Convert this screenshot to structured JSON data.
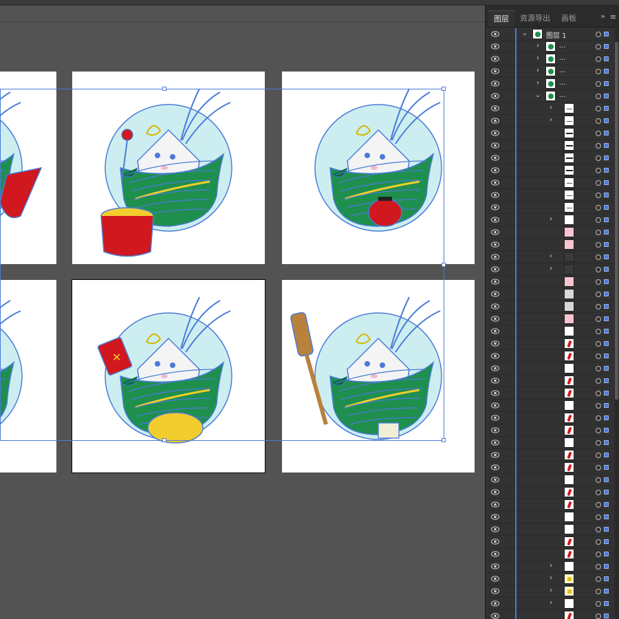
{
  "panel": {
    "tabs": [
      "图层",
      "资源导出",
      "画板"
    ],
    "active_tab": 0,
    "collapse_glyph": "»",
    "menu_glyph": "≡"
  },
  "layers": [
    {
      "name": "图层 1",
      "depth": 0,
      "expander": "open",
      "thumb": "artwork"
    },
    {
      "name": "...",
      "depth": 1,
      "expander": "closed",
      "thumb": "artwork"
    },
    {
      "name": "...",
      "depth": 1,
      "expander": "closed",
      "thumb": "artwork"
    },
    {
      "name": "...",
      "depth": 1,
      "expander": "closed",
      "thumb": "artwork"
    },
    {
      "name": "...",
      "depth": 1,
      "expander": "closed",
      "thumb": "artwork"
    },
    {
      "name": "...",
      "depth": 1,
      "expander": "open",
      "thumb": "artwork"
    },
    {
      "name": "",
      "depth": 2,
      "expander": "closed",
      "thumb": "line"
    },
    {
      "name": "",
      "depth": 2,
      "expander": "closed",
      "thumb": "line"
    },
    {
      "name": "",
      "depth": 2,
      "expander": "none",
      "thumb": "black"
    },
    {
      "name": "",
      "depth": 2,
      "expander": "none",
      "thumb": "black"
    },
    {
      "name": "",
      "depth": 2,
      "expander": "none",
      "thumb": "black"
    },
    {
      "name": "",
      "depth": 2,
      "expander": "none",
      "thumb": "black"
    },
    {
      "name": "",
      "depth": 2,
      "expander": "none",
      "thumb": "line"
    },
    {
      "name": "",
      "depth": 2,
      "expander": "none",
      "thumb": "line"
    },
    {
      "name": "",
      "depth": 2,
      "expander": "none",
      "thumb": "line"
    },
    {
      "name": "",
      "depth": 2,
      "expander": "closed",
      "thumb": "blank"
    },
    {
      "name": "",
      "depth": 2,
      "expander": "none",
      "thumb": "pink"
    },
    {
      "name": "",
      "depth": 2,
      "expander": "none",
      "thumb": "pink"
    },
    {
      "name": "",
      "depth": 2,
      "expander": "closed",
      "thumb": "dark"
    },
    {
      "name": "",
      "depth": 2,
      "expander": "closed",
      "thumb": "dark"
    },
    {
      "name": "",
      "depth": 2,
      "expander": "none",
      "thumb": "pink"
    },
    {
      "name": "",
      "depth": 2,
      "expander": "none",
      "thumb": "grey"
    },
    {
      "name": "",
      "depth": 2,
      "expander": "none",
      "thumb": "grey"
    },
    {
      "name": "",
      "depth": 2,
      "expander": "none",
      "thumb": "pink"
    },
    {
      "name": "",
      "depth": 2,
      "expander": "none",
      "thumb": "blank"
    },
    {
      "name": "",
      "depth": 2,
      "expander": "none",
      "thumb": "red"
    },
    {
      "name": "",
      "depth": 2,
      "expander": "none",
      "thumb": "red"
    },
    {
      "name": "",
      "depth": 2,
      "expander": "none",
      "thumb": "blank"
    },
    {
      "name": "",
      "depth": 2,
      "expander": "none",
      "thumb": "red"
    },
    {
      "name": "",
      "depth": 2,
      "expander": "none",
      "thumb": "red"
    },
    {
      "name": "",
      "depth": 2,
      "expander": "none",
      "thumb": "blank"
    },
    {
      "name": "",
      "depth": 2,
      "expander": "none",
      "thumb": "red"
    },
    {
      "name": "",
      "depth": 2,
      "expander": "none",
      "thumb": "red"
    },
    {
      "name": "",
      "depth": 2,
      "expander": "none",
      "thumb": "blank"
    },
    {
      "name": "",
      "depth": 2,
      "expander": "none",
      "thumb": "red"
    },
    {
      "name": "",
      "depth": 2,
      "expander": "none",
      "thumb": "red"
    },
    {
      "name": "",
      "depth": 2,
      "expander": "none",
      "thumb": "blank"
    },
    {
      "name": "",
      "depth": 2,
      "expander": "none",
      "thumb": "red"
    },
    {
      "name": "",
      "depth": 2,
      "expander": "none",
      "thumb": "red"
    },
    {
      "name": "",
      "depth": 2,
      "expander": "none",
      "thumb": "blank"
    },
    {
      "name": "",
      "depth": 2,
      "expander": "none",
      "thumb": "blank"
    },
    {
      "name": "",
      "depth": 2,
      "expander": "none",
      "thumb": "red"
    },
    {
      "name": "",
      "depth": 2,
      "expander": "none",
      "thumb": "red"
    },
    {
      "name": "",
      "depth": 2,
      "expander": "closed",
      "thumb": "blank"
    },
    {
      "name": "",
      "depth": 2,
      "expander": "closed",
      "thumb": "yellow"
    },
    {
      "name": "",
      "depth": 2,
      "expander": "closed",
      "thumb": "yellow"
    },
    {
      "name": "",
      "depth": 2,
      "expander": "closed",
      "thumb": "blank"
    },
    {
      "name": "",
      "depth": 2,
      "expander": "none",
      "thumb": "red"
    },
    {
      "name": "",
      "depth": 2,
      "expander": "none",
      "thumb": "yellow"
    },
    {
      "name": "",
      "depth": 2,
      "expander": "none",
      "thumb": "blank"
    }
  ],
  "colors": {
    "selection": "#4a7bd8",
    "zongzi_green": "#1f8f4e",
    "zongzi_dark": "#0c6b3a",
    "halo": "#cdeef0",
    "prop_red": "#d0181e",
    "prop_yellow": "#f2cd2e",
    "paddle_brown": "#b8823c",
    "rice_white": "#f4f4f4"
  },
  "artboards": [
    {
      "prop": "drum",
      "active": false
    },
    {
      "prop": "lantern",
      "active": false
    },
    {
      "prop": "card",
      "active": true
    },
    {
      "prop": "paddle",
      "active": false
    },
    {
      "prop": "cape",
      "active": false
    },
    {
      "prop": "none",
      "active": false
    }
  ]
}
